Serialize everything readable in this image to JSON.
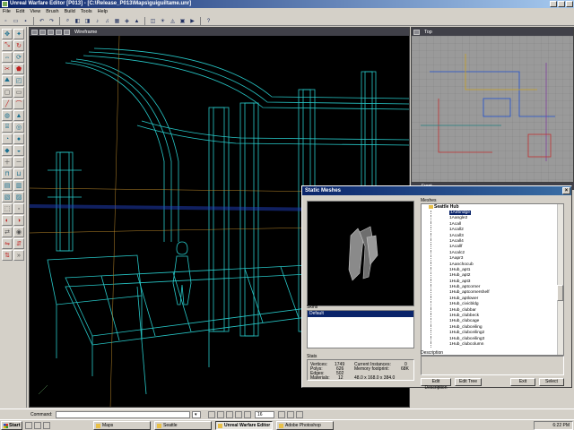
{
  "window": {
    "title": "Unreal Warfare Editor [P013] - [C:\\Release_P013\\Maps\\guiguiltame.unr]"
  },
  "menu": [
    "File",
    "Edit",
    "View",
    "Brush",
    "Build",
    "Tools",
    "Help"
  ],
  "viewports": {
    "main_title": "Wireframe",
    "top_title": "Top",
    "small_title": "Front"
  },
  "dialog": {
    "title": "Static Meshes",
    "close": "×",
    "skins_label": "Skins",
    "skins": [
      "Default"
    ],
    "meshes_label": "Meshes",
    "tree_root": "Seattle Hub",
    "tree_items": [
      "1Airbridge",
      "1Aangle2",
      "1Acall",
      "1Acall2",
      "1Acall3",
      "1Acall4",
      "1Acallf",
      "1Acalc2",
      "1Aapr3",
      "1Aanchocub",
      "1Hub_apt1",
      "1Hub_apt2",
      "1Hub_apt3",
      "1Hub_aptcorner",
      "1Hub_aptcornershelf",
      "1Hub_aptlower",
      "1Hub_civicbldg",
      "1Hub_clubbar",
      "1Hub_clubbeck",
      "1Hub_clubcage",
      "1Hub_clubceiling",
      "1Hub_clubceiling2",
      "1Hub_clubceiling3",
      "1Hub_clubcolumn"
    ],
    "selected_index": 0,
    "stats_label": "Stats",
    "stats": {
      "vertices_label": "Vertices:",
      "vertices": "1749",
      "polys_label": "Polys:",
      "polys": "626",
      "edges_label": "Edges:",
      "edges": "502",
      "materials_label": "Materials:",
      "materials": "12",
      "instances_label": "Current Instances:",
      "instances": "0",
      "memory_label": "Memory footprint:",
      "memory": "68K",
      "size": "48.0 x 168.0 x 384.0"
    },
    "description_label": "Description",
    "buttons": {
      "edit_description": "Edit Description",
      "edit_tree": "Edit Tree",
      "exit": "Exit",
      "select": "Select"
    }
  },
  "statusbar": {
    "command_label": "Command:",
    "grid_value": "16"
  },
  "taskbar": {
    "start": "Start",
    "tasks": [
      "Maps",
      "Seattle",
      "Unreal Warfare Editor ...",
      "Adobe Photoshop"
    ],
    "clock": "6:22 PM"
  },
  "colors": {
    "wire": "#27c8c8",
    "accent": "#0a246a"
  }
}
